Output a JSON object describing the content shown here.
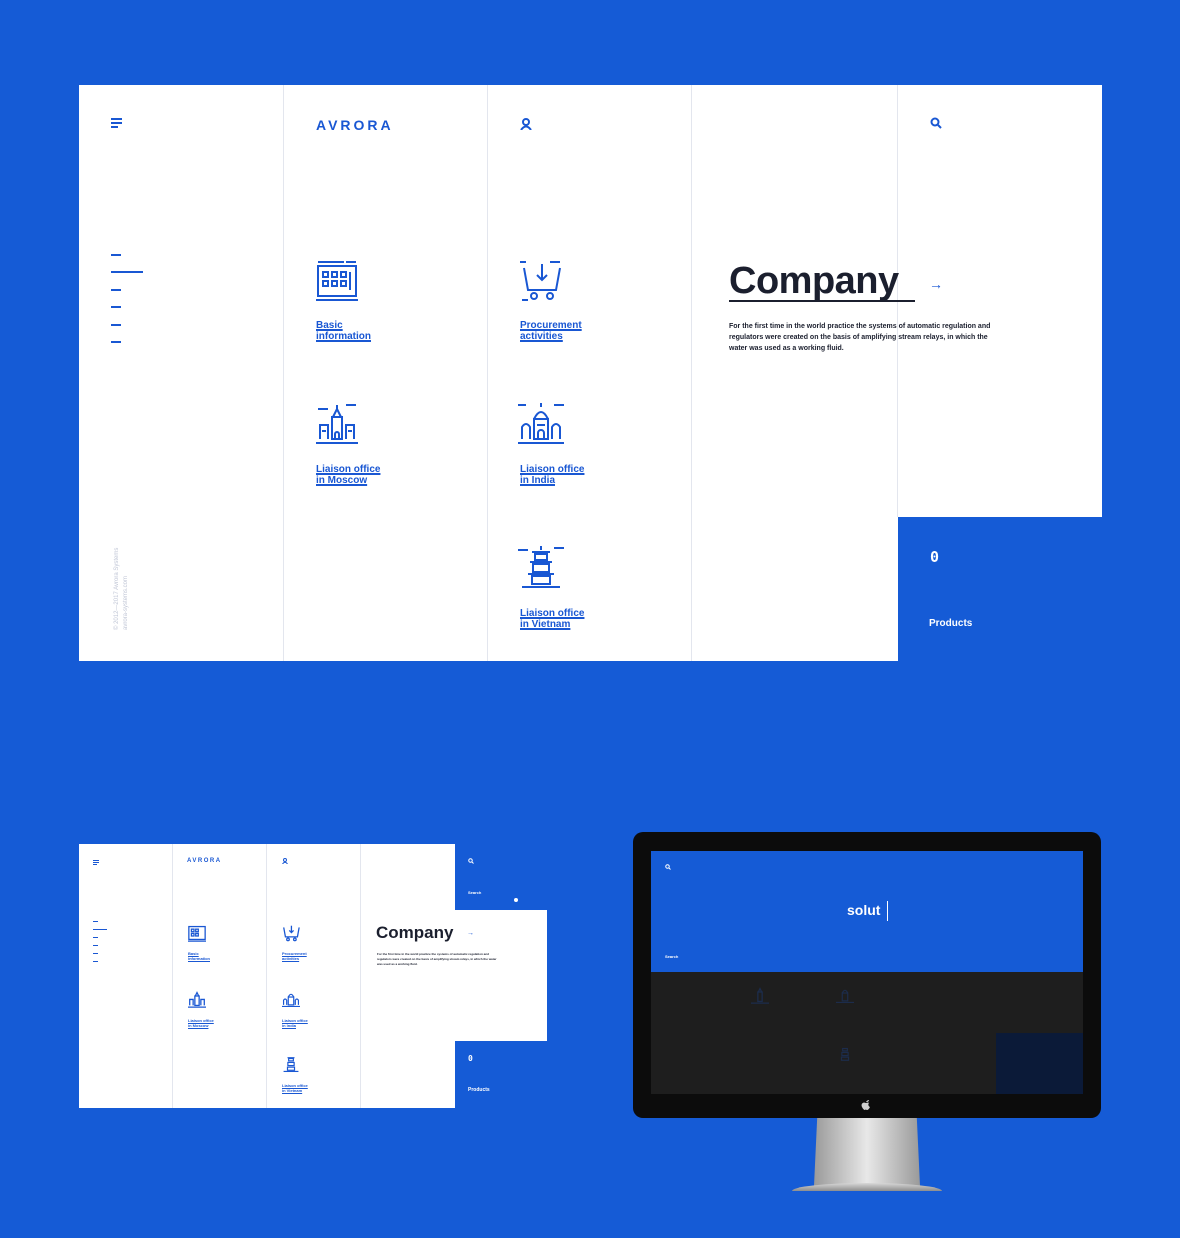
{
  "brand": {
    "logo": "AVRORA"
  },
  "main": {
    "tiles": [
      {
        "label": "Basic\ninformation",
        "icon": "office-building-icon"
      },
      {
        "label": "Procurement\nactivities",
        "icon": "shopping-cart-icon"
      },
      {
        "label": "Liaison office\nin Moscow",
        "icon": "kremlin-icon"
      },
      {
        "label": "Liaison office\nin India",
        "icon": "temple-icon"
      },
      {
        "label": "Liaison office\nin Vietnam",
        "icon": "pagoda-icon"
      }
    ],
    "company": {
      "title": "Company",
      "arrow": "→",
      "description": "For the first time in the world practice the systems of automatic regulation and regulators were created on the basis of amplifying stream relays, in which the water was used as a working fluid."
    },
    "cart": {
      "count": "0",
      "label": "Products"
    },
    "copyright": "© 2012—2017 Avrora Systems",
    "copyright_url": "avrora-systems.com"
  },
  "small": {
    "search_label": "Search",
    "products_label": "Products",
    "cart_count": "0"
  },
  "monitor": {
    "search_value": "solut",
    "search_label": "Search"
  },
  "colors": {
    "background": "#155bd6",
    "accent": "#1957d3",
    "text_dark": "#1b1f2e"
  }
}
